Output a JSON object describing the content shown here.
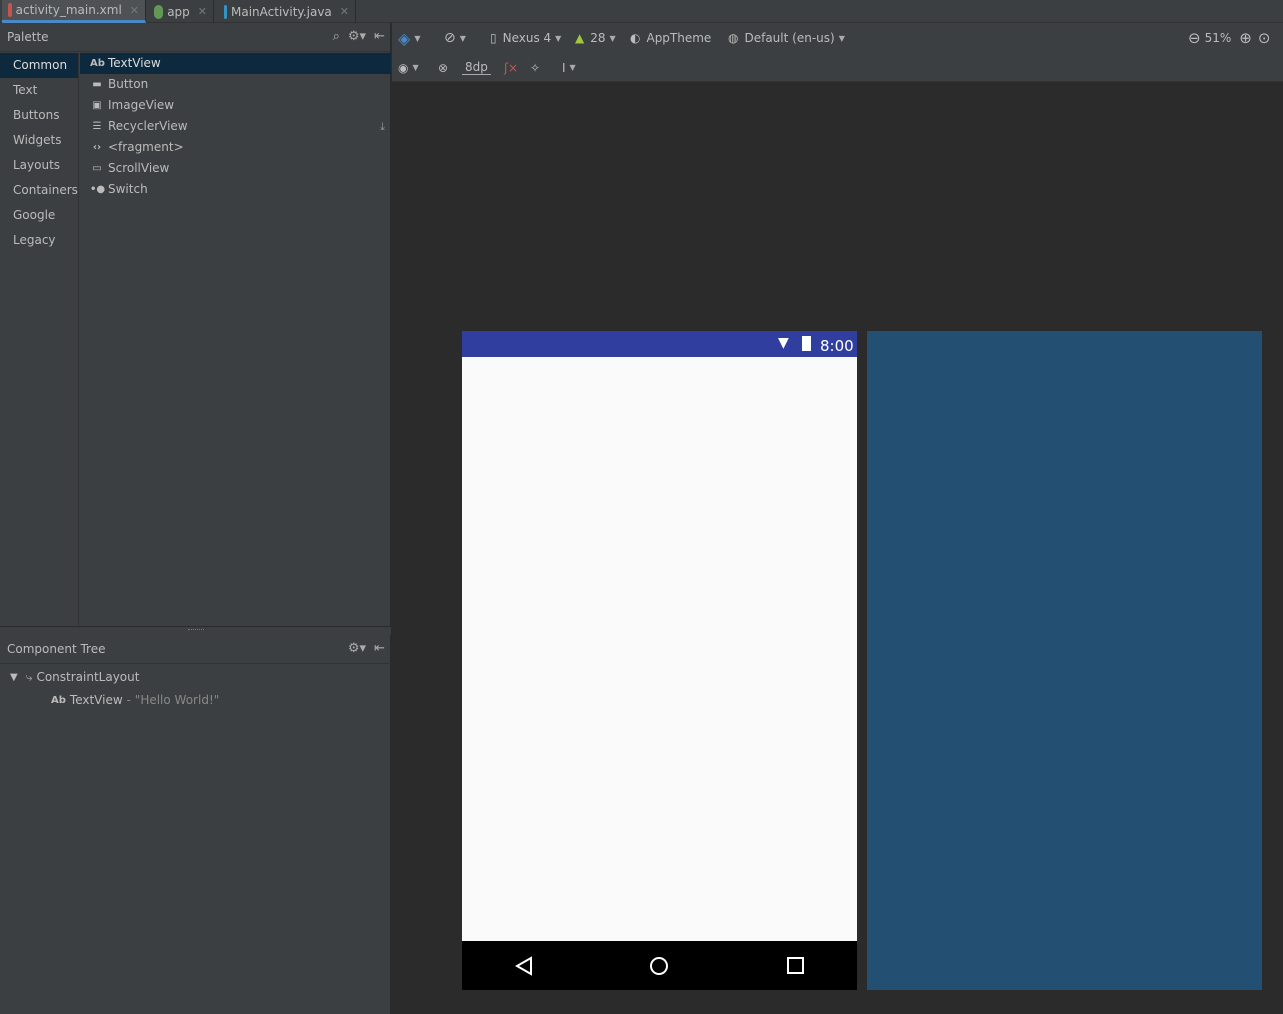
{
  "tabs": [
    {
      "label": "activity_main.xml",
      "icon": "layout-xml-icon",
      "active": true
    },
    {
      "label": "app",
      "icon": "gradle-app-icon",
      "active": false
    },
    {
      "label": "MainActivity.java",
      "icon": "java-class-icon",
      "active": false
    }
  ],
  "palette": {
    "title": "Palette",
    "categories": [
      "Common",
      "Text",
      "Buttons",
      "Widgets",
      "Layouts",
      "Containers",
      "Google",
      "Legacy"
    ],
    "selected_category": "Common",
    "widgets": [
      {
        "label": "TextView",
        "icon": "textview-icon",
        "glyph": "Ab"
      },
      {
        "label": "Button",
        "icon": "button-icon"
      },
      {
        "label": "ImageView",
        "icon": "image-icon"
      },
      {
        "label": "RecyclerView",
        "icon": "list-icon"
      },
      {
        "label": "<fragment>",
        "icon": "code-brackets-icon"
      },
      {
        "label": "ScrollView",
        "icon": "scrollview-icon"
      },
      {
        "label": "Switch",
        "icon": "switch-icon"
      }
    ]
  },
  "component_tree": {
    "title": "Component Tree",
    "root": "ConstraintLayout",
    "child_glyph": "Ab",
    "child": "TextView",
    "child_text": "- \"Hello World!\""
  },
  "toolbar": {
    "device": "Nexus 4",
    "api": "28",
    "theme": "AppTheme",
    "locale": "Default (en-us)",
    "zoom": "51%",
    "margin": "8dp"
  },
  "device_preview": {
    "time": "8:00"
  },
  "colors": {
    "status_bar": "#303f9f",
    "blueprint": "#234f73",
    "selection": "#0d293e"
  }
}
